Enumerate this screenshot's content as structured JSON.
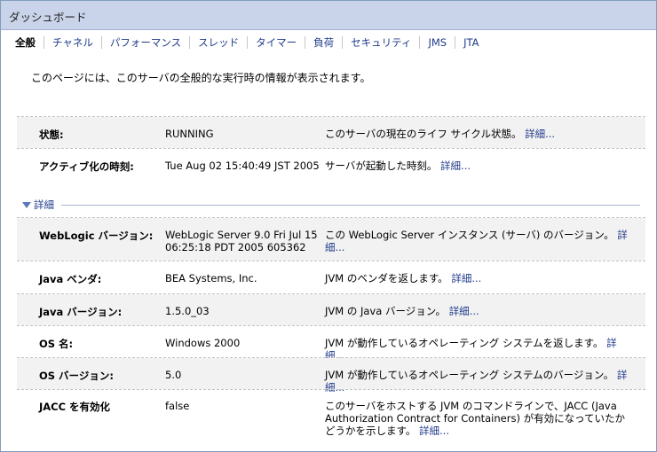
{
  "window": {
    "title": "ダッシュボード"
  },
  "tabs": [
    {
      "label": "全般",
      "active": true
    },
    {
      "label": "チャネル"
    },
    {
      "label": "パフォーマンス"
    },
    {
      "label": "スレッド"
    },
    {
      "label": "タイマー"
    },
    {
      "label": "負荷"
    },
    {
      "label": "セキュリティ"
    },
    {
      "label": "JMS"
    },
    {
      "label": "JTA"
    }
  ],
  "description": "このページには、このサーバの全般的な実行時の情報が表示されます。",
  "detail_toggle": "詳細",
  "more_link": "詳細...",
  "rows": [
    {
      "label": "状態:",
      "value": "RUNNING",
      "text": "このサーバの現在のライフ サイクル状態。"
    },
    {
      "label": "アクティブ化の時刻:",
      "value": "Tue Aug 02 15:40:49 JST 2005",
      "text": "サーバが起動した時刻。"
    },
    {
      "label": "WebLogic バージョン:",
      "value": "WebLogic Server 9.0 Fri Jul 15 06:25:18 PDT 2005 605362",
      "text": "この WebLogic Server インスタンス (サーバ) のバージョン。"
    },
    {
      "label": "Java ベンダ:",
      "value": "BEA Systems, Inc.",
      "text": "JVM のベンダを返します。"
    },
    {
      "label": "Java バージョン:",
      "value": "1.5.0_03",
      "text": "JVM の Java バージョン。"
    },
    {
      "label": "OS 名:",
      "value": "Windows 2000",
      "text": "JVM が動作しているオペレーティング システムを返します。"
    },
    {
      "label": "OS バージョン:",
      "value": "5.0",
      "text": "JVM が動作しているオペレーティング システムのバージョン。"
    },
    {
      "label": "JACC を有効化",
      "value": "false",
      "text": "このサーバをホストする JVM のコマンドラインで、JACC (Java Authorization Contract for Containers) が有効になっていたかどうかを示します。"
    }
  ]
}
